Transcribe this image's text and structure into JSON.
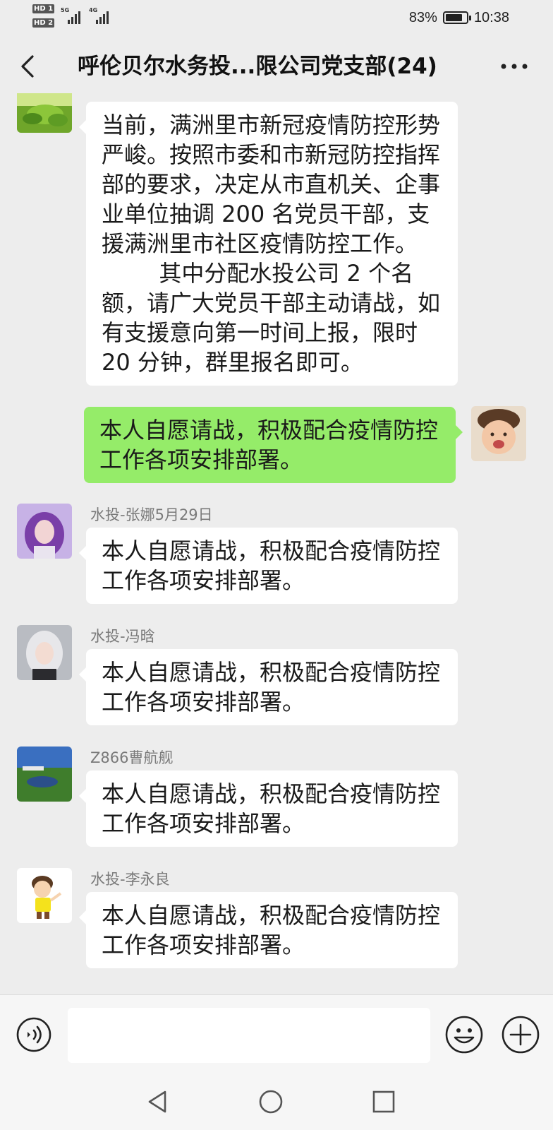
{
  "status_bar": {
    "sim1": "HD 1",
    "sim2": "HD 2",
    "net1": "5G",
    "net2": "4G",
    "battery": "83%",
    "battery_level": 0.83,
    "time": "10:38"
  },
  "header": {
    "title": "呼伦贝尔水务投...限公司党支部(24)",
    "back_icon": "chevron-left-icon",
    "more_icon": "more-dots-icon"
  },
  "messages": [
    {
      "direction": "in",
      "text": "当前，满洲里市新冠疫情防控形势严峻。按照市委和市新冠防控指挥部的要求，决定从市直机关、企事业单位抽调 200 名党员干部，支援满洲里市社区疫情防控工作。\n        其中分配水投公司 2 个名额，请广大党员干部主动请战，如有支援意向第一时间上报，限时 20 分钟，群里报名即可。"
    },
    {
      "direction": "out",
      "text": "本人自愿请战，积极配合疫情防控工作各项安排部署。"
    },
    {
      "direction": "in",
      "sender": "水投-张娜5月29日",
      "text": "本人自愿请战，积极配合疫情防控工作各项安排部署。"
    },
    {
      "direction": "in",
      "sender": "水投-冯晗",
      "text": "本人自愿请战，积极配合疫情防控工作各项安排部署。"
    },
    {
      "direction": "in",
      "sender": "Z866曹航舰",
      "text": "本人自愿请战，积极配合疫情防控工作各项安排部署。"
    },
    {
      "direction": "in",
      "sender": "水投-李永良",
      "text": "本人自愿请战，积极配合疫情防控工作各项安排部署。"
    }
  ],
  "input_bar": {
    "voice_icon": "voice-icon",
    "input_value": "",
    "emoji_icon": "emoji-icon",
    "plus_icon": "plus-icon"
  },
  "nav": {
    "back_icon": "nav-back-icon",
    "home_icon": "nav-home-icon",
    "recents_icon": "nav-recents-icon"
  },
  "colors": {
    "background": "#ededed",
    "bubble_in": "#ffffff",
    "bubble_out": "#95ec69",
    "sender_text": "#7a7a7a"
  }
}
